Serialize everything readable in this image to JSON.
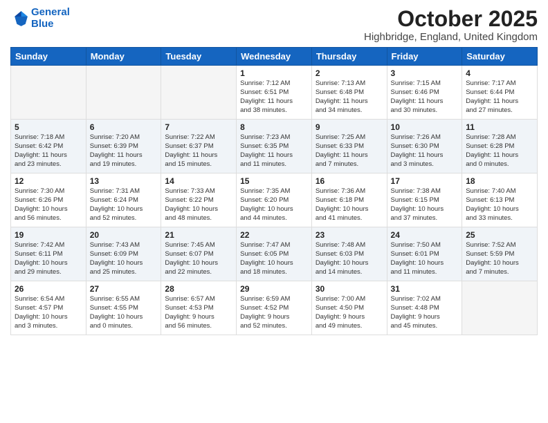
{
  "header": {
    "logo_line1": "General",
    "logo_line2": "Blue",
    "month": "October 2025",
    "location": "Highbridge, England, United Kingdom"
  },
  "weekdays": [
    "Sunday",
    "Monday",
    "Tuesday",
    "Wednesday",
    "Thursday",
    "Friday",
    "Saturday"
  ],
  "weeks": [
    [
      {
        "day": "",
        "info": ""
      },
      {
        "day": "",
        "info": ""
      },
      {
        "day": "",
        "info": ""
      },
      {
        "day": "1",
        "info": "Sunrise: 7:12 AM\nSunset: 6:51 PM\nDaylight: 11 hours\nand 38 minutes."
      },
      {
        "day": "2",
        "info": "Sunrise: 7:13 AM\nSunset: 6:48 PM\nDaylight: 11 hours\nand 34 minutes."
      },
      {
        "day": "3",
        "info": "Sunrise: 7:15 AM\nSunset: 6:46 PM\nDaylight: 11 hours\nand 30 minutes."
      },
      {
        "day": "4",
        "info": "Sunrise: 7:17 AM\nSunset: 6:44 PM\nDaylight: 11 hours\nand 27 minutes."
      }
    ],
    [
      {
        "day": "5",
        "info": "Sunrise: 7:18 AM\nSunset: 6:42 PM\nDaylight: 11 hours\nand 23 minutes."
      },
      {
        "day": "6",
        "info": "Sunrise: 7:20 AM\nSunset: 6:39 PM\nDaylight: 11 hours\nand 19 minutes."
      },
      {
        "day": "7",
        "info": "Sunrise: 7:22 AM\nSunset: 6:37 PM\nDaylight: 11 hours\nand 15 minutes."
      },
      {
        "day": "8",
        "info": "Sunrise: 7:23 AM\nSunset: 6:35 PM\nDaylight: 11 hours\nand 11 minutes."
      },
      {
        "day": "9",
        "info": "Sunrise: 7:25 AM\nSunset: 6:33 PM\nDaylight: 11 hours\nand 7 minutes."
      },
      {
        "day": "10",
        "info": "Sunrise: 7:26 AM\nSunset: 6:30 PM\nDaylight: 11 hours\nand 3 minutes."
      },
      {
        "day": "11",
        "info": "Sunrise: 7:28 AM\nSunset: 6:28 PM\nDaylight: 11 hours\nand 0 minutes."
      }
    ],
    [
      {
        "day": "12",
        "info": "Sunrise: 7:30 AM\nSunset: 6:26 PM\nDaylight: 10 hours\nand 56 minutes."
      },
      {
        "day": "13",
        "info": "Sunrise: 7:31 AM\nSunset: 6:24 PM\nDaylight: 10 hours\nand 52 minutes."
      },
      {
        "day": "14",
        "info": "Sunrise: 7:33 AM\nSunset: 6:22 PM\nDaylight: 10 hours\nand 48 minutes."
      },
      {
        "day": "15",
        "info": "Sunrise: 7:35 AM\nSunset: 6:20 PM\nDaylight: 10 hours\nand 44 minutes."
      },
      {
        "day": "16",
        "info": "Sunrise: 7:36 AM\nSunset: 6:18 PM\nDaylight: 10 hours\nand 41 minutes."
      },
      {
        "day": "17",
        "info": "Sunrise: 7:38 AM\nSunset: 6:15 PM\nDaylight: 10 hours\nand 37 minutes."
      },
      {
        "day": "18",
        "info": "Sunrise: 7:40 AM\nSunset: 6:13 PM\nDaylight: 10 hours\nand 33 minutes."
      }
    ],
    [
      {
        "day": "19",
        "info": "Sunrise: 7:42 AM\nSunset: 6:11 PM\nDaylight: 10 hours\nand 29 minutes."
      },
      {
        "day": "20",
        "info": "Sunrise: 7:43 AM\nSunset: 6:09 PM\nDaylight: 10 hours\nand 25 minutes."
      },
      {
        "day": "21",
        "info": "Sunrise: 7:45 AM\nSunset: 6:07 PM\nDaylight: 10 hours\nand 22 minutes."
      },
      {
        "day": "22",
        "info": "Sunrise: 7:47 AM\nSunset: 6:05 PM\nDaylight: 10 hours\nand 18 minutes."
      },
      {
        "day": "23",
        "info": "Sunrise: 7:48 AM\nSunset: 6:03 PM\nDaylight: 10 hours\nand 14 minutes."
      },
      {
        "day": "24",
        "info": "Sunrise: 7:50 AM\nSunset: 6:01 PM\nDaylight: 10 hours\nand 11 minutes."
      },
      {
        "day": "25",
        "info": "Sunrise: 7:52 AM\nSunset: 5:59 PM\nDaylight: 10 hours\nand 7 minutes."
      }
    ],
    [
      {
        "day": "26",
        "info": "Sunrise: 6:54 AM\nSunset: 4:57 PM\nDaylight: 10 hours\nand 3 minutes."
      },
      {
        "day": "27",
        "info": "Sunrise: 6:55 AM\nSunset: 4:55 PM\nDaylight: 10 hours\nand 0 minutes."
      },
      {
        "day": "28",
        "info": "Sunrise: 6:57 AM\nSunset: 4:53 PM\nDaylight: 9 hours\nand 56 minutes."
      },
      {
        "day": "29",
        "info": "Sunrise: 6:59 AM\nSunset: 4:52 PM\nDaylight: 9 hours\nand 52 minutes."
      },
      {
        "day": "30",
        "info": "Sunrise: 7:00 AM\nSunset: 4:50 PM\nDaylight: 9 hours\nand 49 minutes."
      },
      {
        "day": "31",
        "info": "Sunrise: 7:02 AM\nSunset: 4:48 PM\nDaylight: 9 hours\nand 45 minutes."
      },
      {
        "day": "",
        "info": ""
      }
    ]
  ]
}
